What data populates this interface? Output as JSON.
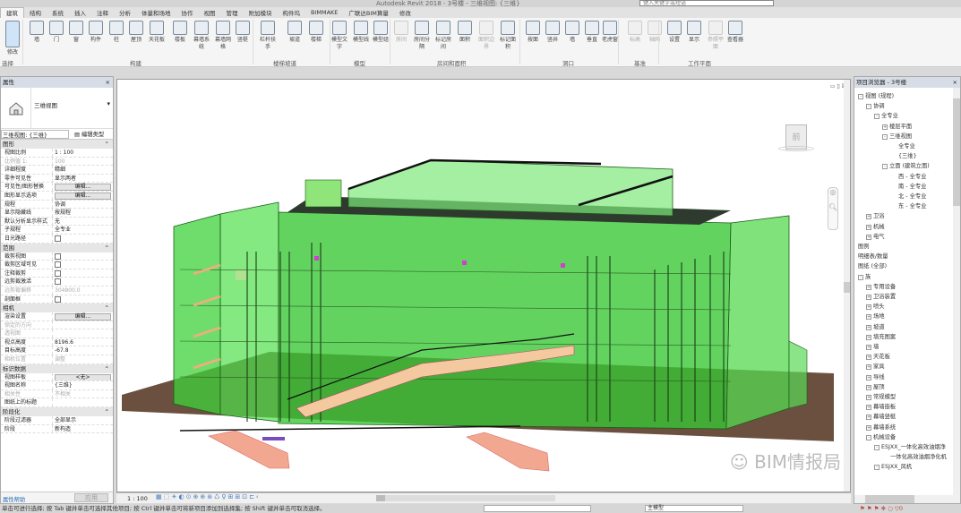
{
  "window": {
    "title": "Autodesk Revit 2018 -   3号楼 - 三维视图: {三维}",
    "search_placeholder": "键入关键字或短语"
  },
  "tabs": [
    "建筑",
    "结构",
    "系统",
    "插入",
    "注释",
    "分析",
    "体量和场地",
    "协作",
    "视图",
    "管理",
    "附加模块",
    "构件坞",
    "BIMMAKE",
    "广联达BIM算量",
    "修改"
  ],
  "active_tab": "建筑",
  "ribbon": {
    "buttons": [
      "修改",
      "墙",
      "门",
      "窗",
      "构件",
      "柱",
      "屋顶",
      "天花板",
      "楼板",
      "幕墙系统",
      "幕墙网格",
      "竖梃",
      "栏杆扶手",
      "坡道",
      "楼梯",
      "模型文字",
      "模型线",
      "模型组",
      "房间",
      "房间分隔",
      "标记房间",
      "面积",
      "面积边界",
      "标记面积",
      "按面",
      "竖井",
      "墙",
      "垂直",
      "老虎窗",
      "标高",
      "轴网",
      "设置",
      "显示",
      "参照平面",
      "查看器"
    ],
    "panels": [
      "选择",
      "构建",
      "楼梯坡道",
      "模型",
      "房间和面积",
      "洞口",
      "基准",
      "工作平面"
    ]
  },
  "properties": {
    "title": "属性",
    "type_name": "三维视图",
    "selector": "三维视图: {三维}",
    "edit_type": "编辑类型",
    "groups": [
      {
        "name": "图形",
        "rows": [
          {
            "k": "视图比例",
            "v": "1 : 100"
          },
          {
            "k": "比例值 1:",
            "v": "100",
            "dim": true
          },
          {
            "k": "详细程度",
            "v": "精细"
          },
          {
            "k": "零件可见性",
            "v": "显示两者"
          },
          {
            "k": "可见性/图形替换",
            "v": "编辑...",
            "btn": true
          },
          {
            "k": "图形显示选项",
            "v": "编辑...",
            "btn": true
          },
          {
            "k": "规程",
            "v": "协调"
          },
          {
            "k": "显示隐藏线",
            "v": "按规程"
          },
          {
            "k": "默认分析显示样式",
            "v": "无"
          },
          {
            "k": "子规程",
            "v": "全专业"
          },
          {
            "k": "日光路径",
            "v": "",
            "cb": true
          }
        ]
      },
      {
        "name": "范围",
        "rows": [
          {
            "k": "裁剪视图",
            "v": "",
            "cb": true
          },
          {
            "k": "裁剪区域可见",
            "v": "",
            "cb": true
          },
          {
            "k": "注释裁剪",
            "v": "",
            "cb": true
          },
          {
            "k": "远剪裁激活",
            "v": "",
            "cb": true
          },
          {
            "k": "远剪裁偏移",
            "v": "304800.0",
            "dim": true
          },
          {
            "k": "剖面框",
            "v": "",
            "cb": true
          }
        ]
      },
      {
        "name": "相机",
        "rows": [
          {
            "k": "渲染设置",
            "v": "编辑...",
            "btn": true
          },
          {
            "k": "锁定的方向",
            "v": "",
            "dim": true
          },
          {
            "k": "透视图",
            "v": "",
            "dim": true
          },
          {
            "k": "视点高度",
            "v": "8196.6"
          },
          {
            "k": "目标高度",
            "v": "-67.8"
          },
          {
            "k": "相机位置",
            "v": "调整",
            "dim": true
          }
        ]
      },
      {
        "name": "标识数据",
        "rows": [
          {
            "k": "视图样板",
            "v": "<无>",
            "btn": true
          },
          {
            "k": "视图名称",
            "v": "{三维}"
          },
          {
            "k": "相关性",
            "v": "不相关",
            "dim": true
          },
          {
            "k": "图纸上的标题",
            "v": ""
          }
        ]
      },
      {
        "name": "阶段化",
        "rows": [
          {
            "k": "阶段过滤器",
            "v": "全部显示"
          },
          {
            "k": "阶段",
            "v": "新构造"
          }
        ]
      }
    ],
    "help_link": "属性帮助",
    "apply": "应用"
  },
  "view_control": {
    "scale": "1 : 100"
  },
  "browser": {
    "title": "项目浏览器 - 3号楼",
    "nodes": [
      {
        "t": "视图 (规程)",
        "l": 0,
        "pm": "-"
      },
      {
        "t": "协调",
        "l": 1,
        "pm": "-"
      },
      {
        "t": "全专业",
        "l": 2,
        "pm": "-"
      },
      {
        "t": "楼层平面",
        "l": 3,
        "pm": "+"
      },
      {
        "t": "三维视图",
        "l": 3,
        "pm": "-"
      },
      {
        "t": "全专业",
        "l": 5
      },
      {
        "t": "{三维}",
        "l": 5
      },
      {
        "t": "立面 (建筑立面)",
        "l": 3,
        "pm": "-"
      },
      {
        "t": "西 - 全专业",
        "l": 5
      },
      {
        "t": "南 - 全专业",
        "l": 5
      },
      {
        "t": "北 - 全专业",
        "l": 5
      },
      {
        "t": "东 - 全专业",
        "l": 5
      },
      {
        "t": "卫浴",
        "l": 1,
        "pm": "+"
      },
      {
        "t": "机械",
        "l": 1,
        "pm": "+"
      },
      {
        "t": "电气",
        "l": 1,
        "pm": "+"
      },
      {
        "t": "图例",
        "l": 0
      },
      {
        "t": "明细表/数量",
        "l": 0
      },
      {
        "t": "图纸 (全部)",
        "l": 0
      },
      {
        "t": "族",
        "l": 0,
        "pm": "-"
      },
      {
        "t": "专用设备",
        "l": 1,
        "pm": "+"
      },
      {
        "t": "卫浴装置",
        "l": 1,
        "pm": "+"
      },
      {
        "t": "喷头",
        "l": 1,
        "pm": "+"
      },
      {
        "t": "场地",
        "l": 1,
        "pm": "+"
      },
      {
        "t": "坡道",
        "l": 1,
        "pm": "+"
      },
      {
        "t": "填充图案",
        "l": 1,
        "pm": "+"
      },
      {
        "t": "墙",
        "l": 1,
        "pm": "+"
      },
      {
        "t": "天花板",
        "l": 1,
        "pm": "+"
      },
      {
        "t": "家具",
        "l": 1,
        "pm": "+"
      },
      {
        "t": "导线",
        "l": 1,
        "pm": "+"
      },
      {
        "t": "屋顶",
        "l": 1,
        "pm": "+"
      },
      {
        "t": "常规模型",
        "l": 1,
        "pm": "+"
      },
      {
        "t": "幕墙嵌板",
        "l": 1,
        "pm": "+"
      },
      {
        "t": "幕墙竖梃",
        "l": 1,
        "pm": "+"
      },
      {
        "t": "幕墙系统",
        "l": 1,
        "pm": "+"
      },
      {
        "t": "机械设备",
        "l": 1,
        "pm": "-"
      },
      {
        "t": "ESJXX_一体化高效油烟净",
        "l": 2,
        "pm": "-"
      },
      {
        "t": "一体化高效油烟净化机",
        "l": 4
      },
      {
        "t": "ESJXX_风机",
        "l": 2,
        "pm": "-"
      }
    ]
  },
  "status_text": "单击可进行选择; 按 Tab 键并单击可选择其他项目; 按 Ctrl 键并单击可将新项目添加到选择集; 按 Shift 键并单击可取消选择。",
  "workset": "主模型",
  "watermark": "BIM情报局",
  "colors": {
    "model_green": "#3fd13a",
    "ground": "#6b5040",
    "stair": "#f0b090",
    "panel_header": "#d6dde6"
  }
}
